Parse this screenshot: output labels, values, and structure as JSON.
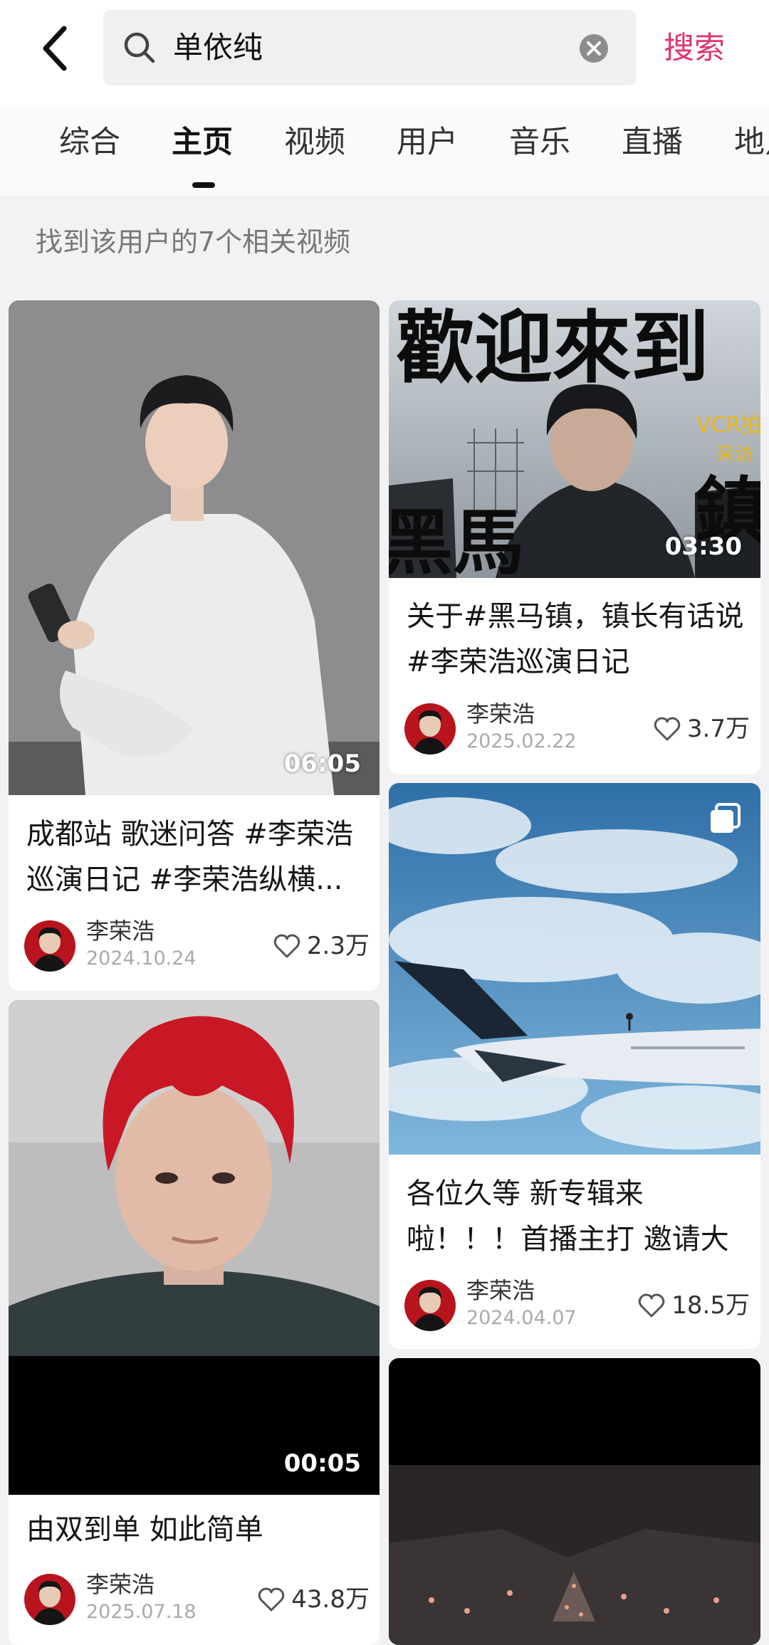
{
  "search": {
    "query": "单依纯",
    "button_label": "搜索"
  },
  "tabs": [
    {
      "label": "综合"
    },
    {
      "label": "主页"
    },
    {
      "label": "视频"
    },
    {
      "label": "用户"
    },
    {
      "label": "音乐"
    },
    {
      "label": "直播"
    },
    {
      "label": "地点"
    }
  ],
  "active_tab": "主页",
  "result_count": "找到该用户的7个相关视频",
  "cards": [
    {
      "title": "成都站 歌迷问答 #李荣浩巡演日记 #李荣浩纵横...",
      "duration": "06:05",
      "author": "李荣浩",
      "date": "2024.10.24",
      "likes": "2.3万"
    },
    {
      "title": "关于#黑马镇，镇长有话说 #李荣浩巡演日记",
      "duration": "03:30",
      "author": "李荣浩",
      "date": "2025.02.22",
      "likes": "3.7万",
      "thumb_text": {
        "big": "歡迎來到",
        "sub1": "VCR拍",
        "sub2": "采访",
        "bottom_left": "黑馬",
        "bottom_right": "鎮"
      }
    },
    {
      "title": "各位久等 新专辑来啦！！！首播主打 邀请大家 看图...",
      "author": "李荣浩",
      "date": "2024.04.07",
      "likes": "18.5万"
    },
    {
      "title": "由双到单 如此简单",
      "duration": "00:05",
      "author": "李荣浩",
      "date": "2025.07.18",
      "likes": "43.8万"
    }
  ],
  "colors": {
    "accent": "#e0346a",
    "page_bg": "#f2f2f4",
    "card_bg": "#ffffff"
  },
  "icons": [
    "back-icon",
    "search-icon",
    "clear-icon",
    "heart-icon",
    "multi-image-icon"
  ]
}
